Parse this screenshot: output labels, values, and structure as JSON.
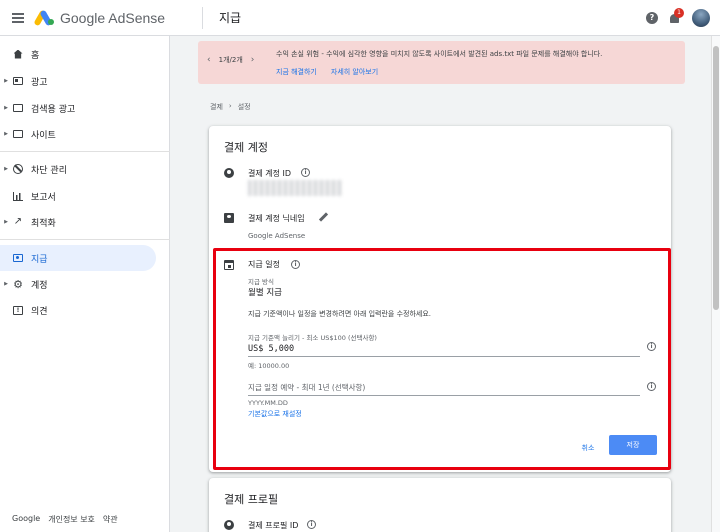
{
  "header": {
    "app_name": "Google AdSense",
    "page_title": "지급",
    "notification_count": "1"
  },
  "sidebar": {
    "items": [
      {
        "label": "홈",
        "icon": "home-icon"
      },
      {
        "label": "광고",
        "icon": "ads-icon"
      },
      {
        "label": "검색용 광고",
        "icon": "search-ads-icon"
      },
      {
        "label": "사이트",
        "icon": "sites-icon"
      },
      {
        "label": "차단 관리",
        "icon": "block-icon"
      },
      {
        "label": "보고서",
        "icon": "reports-icon"
      },
      {
        "label": "최적화",
        "icon": "trend-icon"
      },
      {
        "label": "지급",
        "icon": "payments-icon"
      },
      {
        "label": "계정",
        "icon": "gear-icon"
      },
      {
        "label": "의견",
        "icon": "feedback-icon"
      }
    ],
    "footer": {
      "google": "Google",
      "privacy": "개인정보 보호",
      "terms": "약관"
    }
  },
  "alert": {
    "pager": "1개/2개",
    "message": "수익 손실 위험 - 수익에 심각한 영향을 미치지 않도록 사이트에서 발견된 ads.txt 파일 문제를 해결해야 합니다.",
    "link_fix": "지금 해결하기",
    "link_more": "자세히 알아보기"
  },
  "breadcrumb": {
    "root": "결제",
    "separator": "›",
    "current": "설정"
  },
  "payments_account": {
    "title": "결제 계정",
    "account_id_label": "결제 계정 ID",
    "nickname_label": "결제 계정 닉네임",
    "nickname_value": "Google AdSense"
  },
  "payment_schedule": {
    "title": "지급 일정",
    "method_label": "지급 방식",
    "method_value": "월별 지급",
    "description": "지급 기준액이나 일정을 변경하려면 아래 입력란을 수정하세요.",
    "threshold_label": "지급 기준액 늘리기 - 최소 US$100 (선택사항)",
    "threshold_value": "US$ 5,000",
    "threshold_hint": "예: 10000.00",
    "hold_placeholder": "지급 일정 예약 - 최대 1년 (선택사항)",
    "hold_hint": "YYYY.MM.DD",
    "reset_link": "기본값으로 재설정",
    "cancel": "취소",
    "save": "저장"
  },
  "payments_profile": {
    "title": "결제 프로필",
    "profile_id_label": "결제 프로필 ID"
  },
  "colors": {
    "accent": "#1a73e8",
    "highlight": "#e8000f",
    "alert_bg": "#f6d7d6",
    "save_button": "#4c8bf5"
  }
}
